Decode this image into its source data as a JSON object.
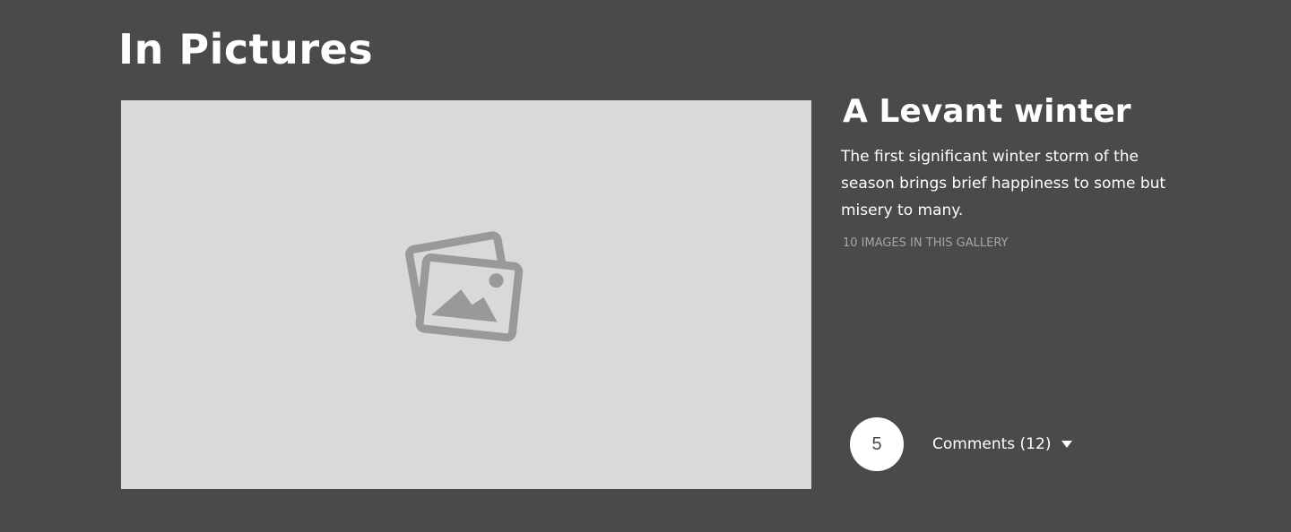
{
  "section": {
    "title": "In Pictures"
  },
  "gallery": {
    "image_icon": "image-placeholder-icon",
    "title": "A Levant winter",
    "description": "The first significant winter storm of the season brings brief happiness to some but misery to many.",
    "count_text": "10 IMAGES IN THIS GALLERY"
  },
  "engagement": {
    "rating": "5",
    "comments_label": "Comments (12)",
    "comments_icon": "caret-down-icon"
  },
  "colors": {
    "background": "#4a4a4a",
    "image_placeholder": "#d9d9d9",
    "icon": "#999999",
    "muted_text": "#a6a6a6"
  }
}
